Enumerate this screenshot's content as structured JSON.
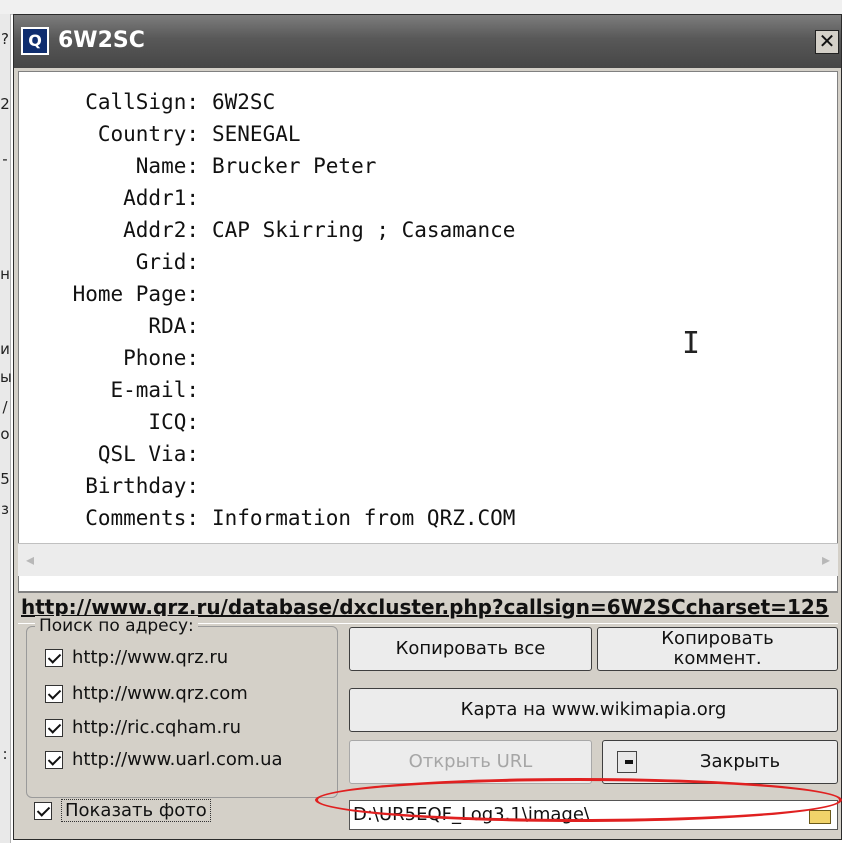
{
  "background": {
    "left_chars": [
      "?",
      "2",
      "-",
      "н",
      "и",
      "ы",
      "/",
      "о",
      "5",
      "з",
      ":"
    ]
  },
  "window": {
    "title": "6W2SC",
    "close_glyph": "✕",
    "icon_text": "Q"
  },
  "info": {
    "rows": [
      {
        "label": "CallSign:",
        "value": "6W2SC"
      },
      {
        "label": "Country:",
        "value": "SENEGAL"
      },
      {
        "label": "Name:",
        "value": "Brucker Peter"
      },
      {
        "label": "Addr1:",
        "value": ""
      },
      {
        "label": "Addr2:",
        "value": "CAP Skirring ; Casamance"
      },
      {
        "label": "Grid:",
        "value": ""
      },
      {
        "label": "Home Page:",
        "value": ""
      },
      {
        "label": "RDA:",
        "value": ""
      },
      {
        "label": "Phone:",
        "value": ""
      },
      {
        "label": "E-mail:",
        "value": ""
      },
      {
        "label": "ICQ:",
        "value": ""
      },
      {
        "label": "QSL Via:",
        "value": ""
      },
      {
        "label": "Birthday:",
        "value": ""
      },
      {
        "label": "Comments:",
        "value": "Information from QRZ.COM"
      }
    ]
  },
  "scrollbar": {
    "left_arrow": "◂",
    "right_arrow": "▸"
  },
  "url_link": "http://www.qrz.ru/database/dxcluster.php?callsign=6W2SCcharset=125",
  "search_group": {
    "legend": "Поиск по адресу:",
    "sites": [
      "http://www.qrz.ru",
      "http://www.qrz.com",
      "http://ric.cqham.ru",
      "http://www.uarl.com.ua"
    ]
  },
  "show_photo_label": "Показать фото",
  "buttons": {
    "copy_all": "Копировать все",
    "copy_comment_line1": "Копировать",
    "copy_comment_line2": "коммент.",
    "wikimapia": "Карта на www.wikimapia.org",
    "open_url": "Открыть URL",
    "close": "Закрыть"
  },
  "photo_path": "D:\\UR5EQF_Log3.1\\image\\",
  "colors": {
    "annotation_oval": "#e02020",
    "titlebar": "#585858"
  }
}
